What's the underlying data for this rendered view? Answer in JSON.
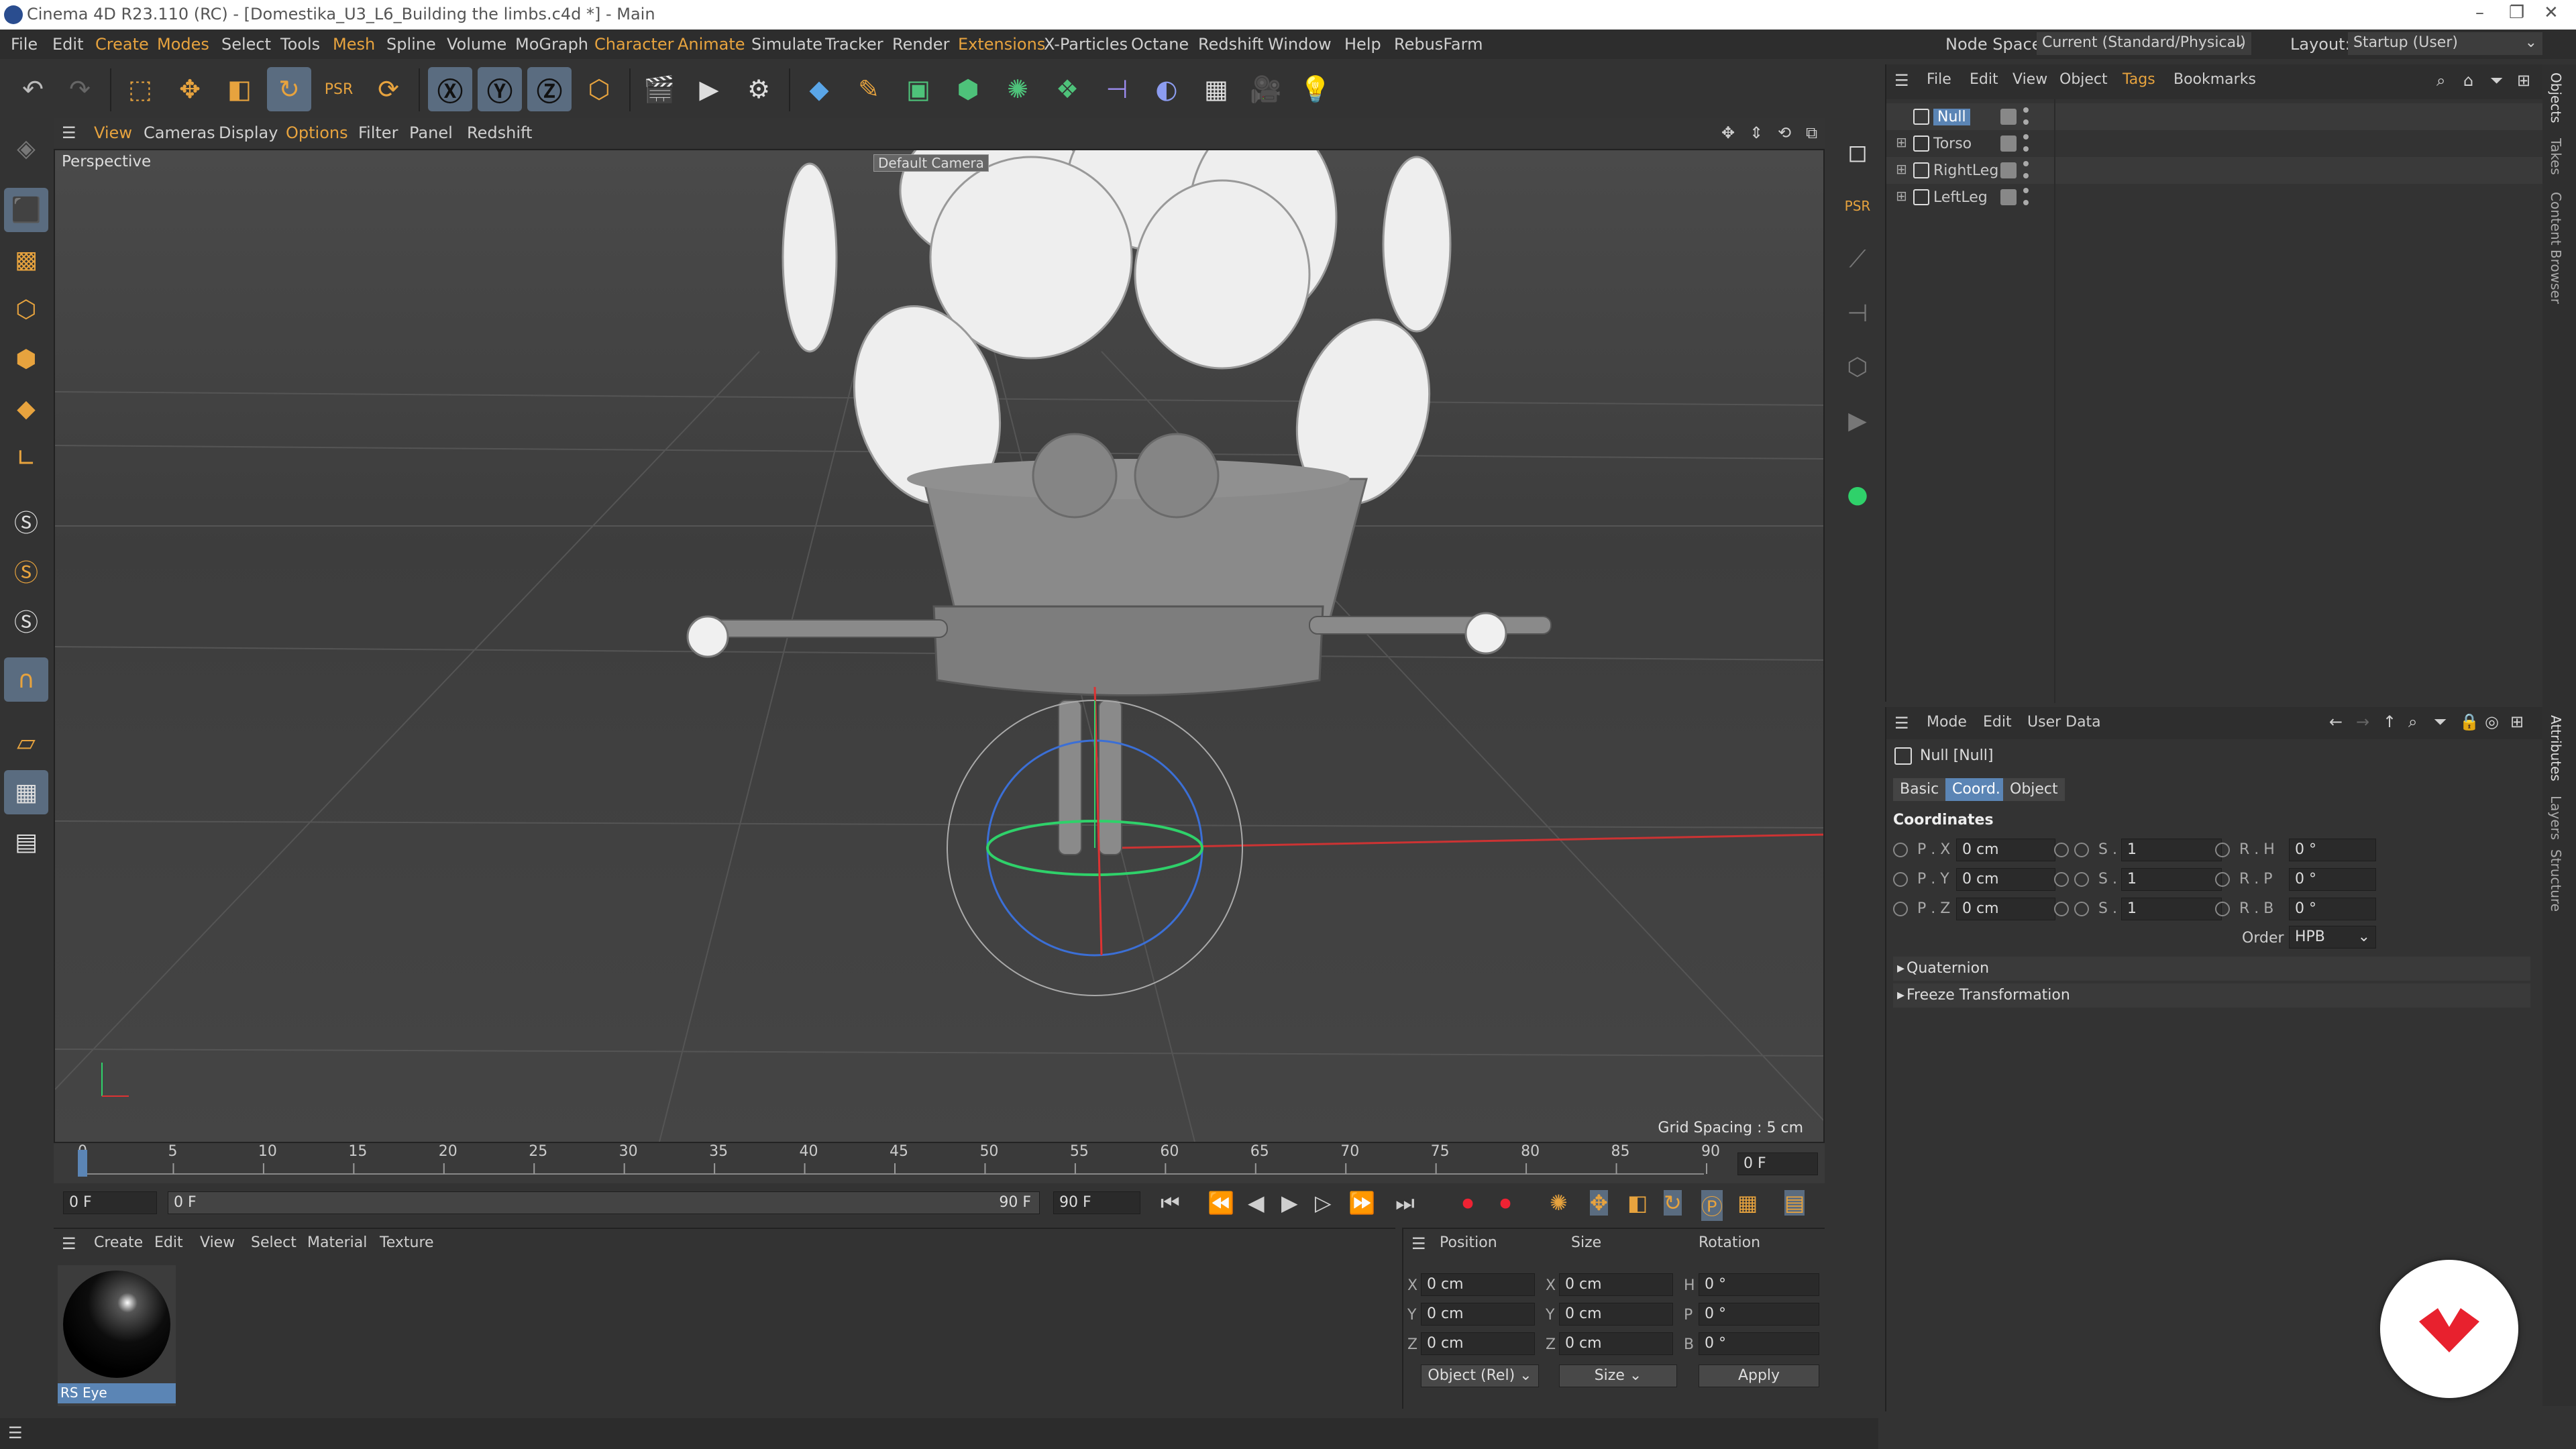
{
  "window": {
    "title": "Cinema 4D R23.110 (RC) - [Domestika_U3_L6_Building the limbs.c4d *] - Main"
  },
  "menu": [
    "File",
    "Edit",
    "Create",
    "Modes",
    "Select",
    "Tools",
    "Mesh",
    "Spline",
    "Volume",
    "MoGraph",
    "Character",
    "Animate",
    "Simulate",
    "Tracker",
    "Render",
    "Extensions",
    "X-Particles",
    "Octane",
    "Redshift",
    "Window",
    "Help",
    "RebusFarm"
  ],
  "menu_highlighted": [
    "Create",
    "Modes",
    "Mesh",
    "Character",
    "Animate",
    "Extensions"
  ],
  "node_space": {
    "label": "Node Space:",
    "value": "Current (Standard/Physical)"
  },
  "layout": {
    "label": "Layout:",
    "value": "Startup (User)"
  },
  "viewport": {
    "menu": [
      "View",
      "Cameras",
      "Display",
      "Options",
      "Filter",
      "Panel",
      "Redshift"
    ],
    "label": "Perspective",
    "camera": "Default Camera",
    "grid_spacing": "Grid Spacing : 5 cm"
  },
  "objects_panel": {
    "menu": [
      "File",
      "Edit",
      "View",
      "Object",
      "Tags",
      "Bookmarks"
    ],
    "items": [
      {
        "name": "Null",
        "selected": true
      },
      {
        "name": "Torso"
      },
      {
        "name": "RightLeg"
      },
      {
        "name": "LeftLeg"
      }
    ]
  },
  "attributes": {
    "menu": [
      "Mode",
      "Edit",
      "User Data"
    ],
    "object_title": "Null [Null]",
    "tabs": [
      "Basic",
      "Coord.",
      "Object"
    ],
    "active_tab": "Coord.",
    "section": "Coordinates",
    "rows": [
      {
        "p_label": "P . X",
        "p": "0 cm",
        "s_label": "S . X",
        "s": "1",
        "r_label": "R . H",
        "r": "0 °"
      },
      {
        "p_label": "P . Y",
        "p": "0 cm",
        "s_label": "S . Y",
        "s": "1",
        "r_label": "R . P",
        "r": "0 °"
      },
      {
        "p_label": "P . Z",
        "p": "0 cm",
        "s_label": "S . Z",
        "s": "1",
        "r_label": "R . B",
        "r": "0 °"
      }
    ],
    "order_label": "Order",
    "order_value": "HPB",
    "collapsed_sections": [
      "Quaternion",
      "Freeze Transformation"
    ]
  },
  "timeline": {
    "ticks": [
      "0",
      "5",
      "10",
      "15",
      "20",
      "25",
      "30",
      "35",
      "40",
      "45",
      "50",
      "55",
      "60",
      "65",
      "70",
      "75",
      "80",
      "85",
      "90"
    ],
    "current_frame": "0 F",
    "start_field": "0 F",
    "range_start": "0 F",
    "range_end": "90 F",
    "end_field": "90 F"
  },
  "material_panel": {
    "menu": [
      "Create",
      "Edit",
      "View",
      "Select",
      "Material",
      "Texture"
    ],
    "materials": [
      {
        "name": "RS Eye"
      }
    ]
  },
  "coord_manager": {
    "headers": [
      "Position",
      "Size",
      "Rotation"
    ],
    "rows": [
      {
        "axis": "X",
        "pos": "0 cm",
        "size_axis": "X",
        "size": "0 cm",
        "rot_axis": "H",
        "rot": "0 °"
      },
      {
        "axis": "Y",
        "pos": "0 cm",
        "size_axis": "Y",
        "size": "0 cm",
        "rot_axis": "P",
        "rot": "0 °"
      },
      {
        "axis": "Z",
        "pos": "0 cm",
        "size_axis": "Z",
        "size": "0 cm",
        "rot_axis": "B",
        "rot": "0 °"
      }
    ],
    "mode": "Object (Rel)",
    "size_mode": "Size",
    "apply": "Apply"
  },
  "side_tabs": [
    "Objects",
    "Takes",
    "Content Browser",
    "Attributes",
    "Layers",
    "Structure"
  ],
  "colors": {
    "accent_orange": "#e7a33e",
    "selection_blue": "#5b85b5",
    "brand_red": "#e8212e"
  }
}
